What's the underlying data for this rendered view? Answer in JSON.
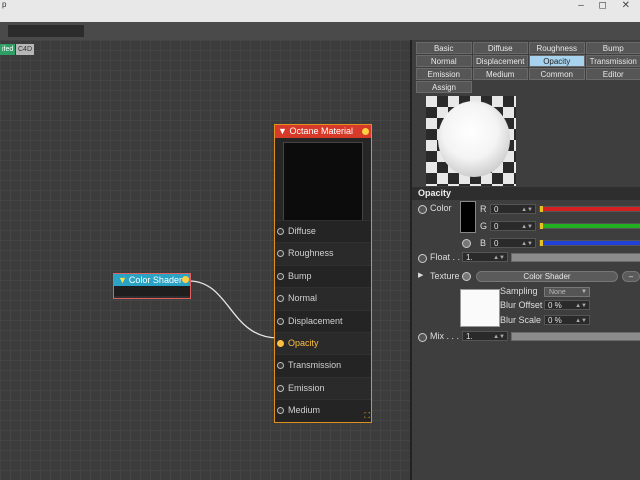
{
  "window": {
    "title_fragment": "p",
    "controls": "– ◻ ✕"
  },
  "canvas_tags": [
    "ifed",
    "C4D"
  ],
  "color_shader_node": {
    "title": "Color Shader"
  },
  "octane_material_node": {
    "title": "Octane Material",
    "ports": [
      "Diffuse",
      "Roughness",
      "Bump",
      "Normal",
      "Displacement",
      "Opacity",
      "Transmission",
      "Emission",
      "Medium"
    ],
    "active_port": "Opacity"
  },
  "panel": {
    "tabs": [
      [
        "Basic",
        "Diffuse",
        "Roughness",
        "Bump"
      ],
      [
        "Normal",
        "Displacement",
        "Opacity",
        "Transmission"
      ],
      [
        "Emission",
        "Medium",
        "Common",
        "Editor"
      ],
      [
        "Assign"
      ]
    ],
    "selected_tab": "Opacity",
    "section_title": "Opacity",
    "color_label": "Color",
    "r_label": "R",
    "g_label": "G",
    "b_label": "B",
    "r_value": "0",
    "g_value": "0",
    "b_value": "0",
    "float_label": "Float . .",
    "float_value": "1.",
    "texture_label": "Texture",
    "texture_button": "Color Shader",
    "sampling_label": "Sampling",
    "sampling_value": "None",
    "blur_offset_label": "Blur Offset",
    "blur_offset_value": "0 %",
    "blur_scale_label": "Blur Scale",
    "blur_scale_value": "0 %",
    "mix_label": "Mix . . .",
    "mix_value": "1.",
    "colors": {
      "r": "#d42020",
      "g": "#20b020",
      "b": "#2040d8"
    }
  }
}
